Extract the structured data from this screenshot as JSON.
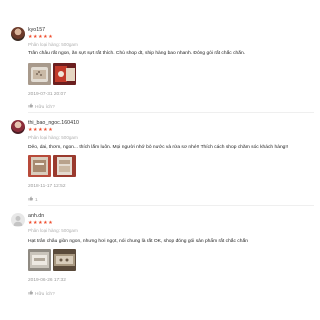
{
  "reviews": [
    {
      "username": "kyo157",
      "stars": "★★★★★",
      "variant": "Phân loại hàng: 500gam",
      "comment": "Trân châu rất ngon, ăn sựt sựt rất thích. Chủ shop dt, ship hàng bao nhanh. Đóng gói rất chắc chắn.",
      "date": "2019-07-31 20:07",
      "like_label": "Hữu ích?",
      "like_icon": "thumbs-up-icon",
      "photo_count": 2
    },
    {
      "username": "thi_bao_ngoc.160410",
      "stars": "★★★★★",
      "variant": "Phân loại hàng: 500gam",
      "comment": "Dẻo, dai, thơm, ngon... thích lắm luôn. Mọi người nhớ bỏ nước và rửa sơ nhé!! Thích cách shop chăm sóc khách hàng!!",
      "date": "2018-11-17 12:52",
      "like_label": "1",
      "like_icon": "thumbs-up-icon",
      "photo_count": 2
    },
    {
      "username": "anh.dn",
      "stars": "★★★★★",
      "variant": "Phân loại hàng: 500gam",
      "comment": "Hạt trân châu giòn ngon, nhưng hơi ngọt, nói chung là rất OK, shop đóng gói sản phẩm rất chắc chắn",
      "date": "2019-06-26 17:32",
      "like_label": "Hữu ích?",
      "like_icon": "thumbs-up-icon",
      "photo_count": 2
    }
  ],
  "colors": {
    "star": "#ee4d2d",
    "muted": "#999999",
    "variant": "#b0b0b0"
  }
}
